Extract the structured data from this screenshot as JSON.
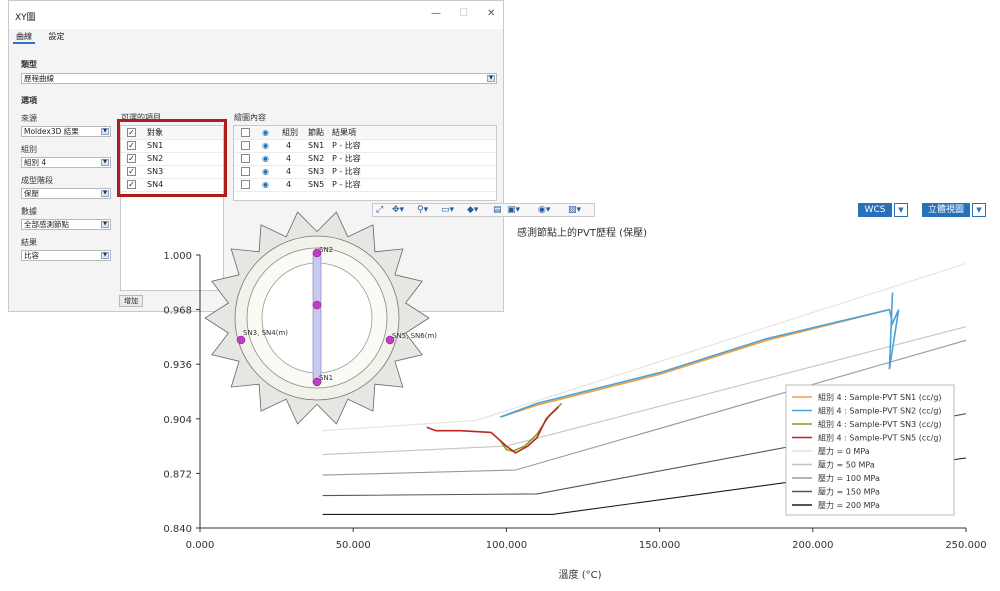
{
  "dialog": {
    "title": "XY圖",
    "tabs": [
      {
        "label": "曲線"
      },
      {
        "label": "設定"
      }
    ],
    "type_label": "類型",
    "type_value": "歷程曲線",
    "options_label": "選項",
    "source_label": "來源",
    "source_value": "Moldex3D 結果",
    "group_label": "組別",
    "group_value": "組別 4",
    "stage_label": "成型階段",
    "stage_value": "保壓",
    "data_label": "數據",
    "data_value": "全部感測節點",
    "result_label": "結果",
    "result_value": "比容",
    "available_label": "可選的項目",
    "available_header": "對象",
    "available_items": [
      "SN1",
      "SN2",
      "SN3",
      "SN4"
    ],
    "add_label": "增加",
    "plot_label": "繪圖內容",
    "plot_headers": {
      "group": "組別",
      "node": "節點",
      "result": "結果項"
    },
    "plot_rows": [
      {
        "group": "4",
        "node": "SN1",
        "result": "P - 比容"
      },
      {
        "group": "4",
        "node": "SN2",
        "result": "P - 比容"
      },
      {
        "group": "4",
        "node": "SN3",
        "result": "P - 比容"
      },
      {
        "group": "4",
        "node": "SN5",
        "result": "P - 比容"
      }
    ]
  },
  "viewer": {
    "wcs_label": "WCS",
    "view_label": "立體視圖",
    "part_labels": {
      "sn1": "SN1",
      "sn2": "SN2",
      "sn3": "SN3, SN4(m)",
      "sn5": "SN5, SN6(m)"
    }
  },
  "colors": {
    "sn1": "#f2a03d",
    "sn2": "#4aa3d8",
    "sn3": "#7ea12a",
    "sn5": "#c0261f",
    "p0": "#e2e2e2",
    "p50": "#c4c4c4",
    "p100": "#9a9a9a",
    "p150": "#555555",
    "p200": "#1a1a1a",
    "accent": "#2a6fba",
    "highlight": "#b31b1b"
  },
  "chart_data": {
    "type": "line",
    "title": "感測節點上的PVT歷程 (保壓)",
    "xlabel": "溫度 (°C)",
    "ylabel": "",
    "xlim": [
      0,
      250
    ],
    "ylim": [
      0.84,
      1.0
    ],
    "xticks": [
      "0.000",
      "50.000",
      "100.000",
      "150.000",
      "200.000",
      "250.000"
    ],
    "yticks": [
      "1.000",
      "0.968",
      "0.936",
      "0.904",
      "0.872",
      "0.840"
    ],
    "legend_position": "right",
    "series": [
      {
        "name": "組別 4 : Sample-PVT SN1 (cc/g)",
        "color": "sn1",
        "x": [
          98,
          110,
          150,
          185,
          225
        ],
        "y": [
          0.905,
          0.912,
          0.93,
          0.95,
          0.968
        ]
      },
      {
        "name": "組別 4 : Sample-PVT SN2 (cc/g)",
        "color": "sn2",
        "x": [
          98,
          110,
          150,
          185,
          225,
          226,
          228,
          225,
          226
        ],
        "y": [
          0.905,
          0.913,
          0.931,
          0.951,
          0.968,
          0.96,
          0.968,
          0.933,
          0.978
        ]
      },
      {
        "name": "組別 4 : Sample-PVT SN3 (cc/g)",
        "color": "sn3",
        "x": [
          98,
          100,
          102,
          106,
          110,
          114,
          118
        ],
        "y": [
          0.891,
          0.886,
          0.885,
          0.888,
          0.895,
          0.906,
          0.913
        ]
      },
      {
        "name": "組別 4 : Sample-PVT SN5 (cc/g)",
        "color": "sn5",
        "x": [
          74,
          77,
          85,
          95,
          100,
          103,
          107,
          110,
          113,
          117
        ],
        "y": [
          0.899,
          0.897,
          0.897,
          0.896,
          0.888,
          0.884,
          0.888,
          0.893,
          0.904,
          0.911
        ]
      },
      {
        "name": "壓力 = 0 MPa",
        "color": "p0",
        "x": [
          40,
          90,
          250
        ],
        "y": [
          0.897,
          0.903,
          0.995
        ]
      },
      {
        "name": "壓力 = 50 MPa",
        "color": "p50",
        "x": [
          40,
          100,
          250
        ],
        "y": [
          0.883,
          0.888,
          0.958
        ]
      },
      {
        "name": "壓力 = 100 MPa",
        "color": "p100",
        "x": [
          40,
          103,
          250
        ],
        "y": [
          0.871,
          0.874,
          0.95
        ]
      },
      {
        "name": "壓力 = 150 MPa",
        "color": "p150",
        "x": [
          40,
          110,
          250
        ],
        "y": [
          0.859,
          0.86,
          0.907
        ]
      },
      {
        "name": "壓力 = 200 MPa",
        "color": "p200",
        "x": [
          40,
          115,
          250
        ],
        "y": [
          0.848,
          0.848,
          0.881
        ]
      }
    ]
  }
}
